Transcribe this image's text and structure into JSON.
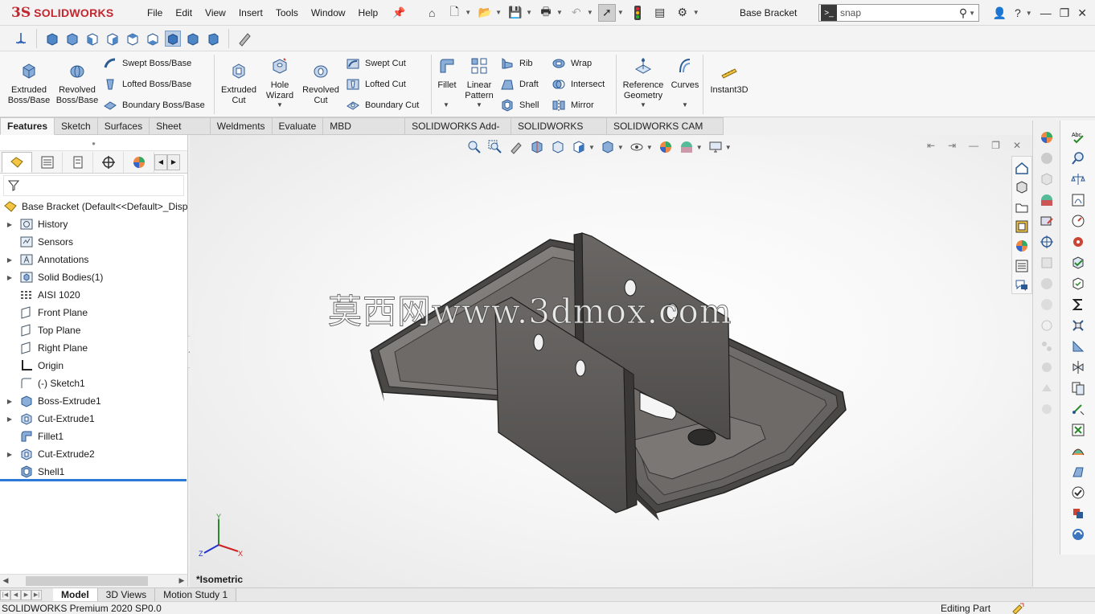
{
  "app": {
    "logo_ds": "3S",
    "logo_text": "SOLIDWORKS",
    "document_title": "Base Bracket"
  },
  "menu": [
    "File",
    "Edit",
    "View",
    "Insert",
    "Tools",
    "Window",
    "Help"
  ],
  "search": {
    "value": "snap"
  },
  "command_manager": {
    "extruded_boss": "Extruded Boss/Base",
    "revolved_boss": "Revolved Boss/Base",
    "swept_boss": "Swept Boss/Base",
    "lofted_boss": "Lofted Boss/Base",
    "boundary_boss": "Boundary Boss/Base",
    "extruded_cut": "Extruded Cut",
    "hole_wizard": "Hole Wizard",
    "revolved_cut": "Revolved Cut",
    "swept_cut": "Swept Cut",
    "lofted_cut": "Lofted Cut",
    "boundary_cut": "Boundary Cut",
    "fillet": "Fillet",
    "linear_pattern": "Linear Pattern",
    "rib": "Rib",
    "draft": "Draft",
    "shell": "Shell",
    "wrap": "Wrap",
    "intersect": "Intersect",
    "mirror": "Mirror",
    "reference_geometry": "Reference Geometry",
    "curves": "Curves",
    "instant3d": "Instant3D"
  },
  "command_tabs": [
    "Features",
    "Sketch",
    "Surfaces",
    "Sheet Metal",
    "Weldments",
    "Evaluate",
    "MBD Dimensions",
    "SOLIDWORKS Add-Ins",
    "SOLIDWORKS CAM",
    "SOLIDWORKS CAM TBM"
  ],
  "feature_tree": {
    "root": "Base Bracket  (Default<<Default>_Disp",
    "items": [
      "History",
      "Sensors",
      "Annotations",
      "Solid Bodies(1)",
      "AISI 1020",
      "Front Plane",
      "Top Plane",
      "Right Plane",
      "Origin",
      "(-) Sketch1",
      "Boss-Extrude1",
      "Cut-Extrude1",
      "Fillet1",
      "Cut-Extrude2",
      "Shell1"
    ]
  },
  "viewport": {
    "watermark": "莫西网www.3dmox.com",
    "view_name": "*Isometric",
    "triad_x": "X",
    "triad_y": "Y",
    "triad_z": "Z"
  },
  "bottom_tabs": [
    "Model",
    "3D Views",
    "Motion Study 1"
  ],
  "status": {
    "left": "SOLIDWORKS Premium 2020 SP0.0",
    "right": "Editing Part"
  },
  "colors": {
    "brand": "#c4262e",
    "model": "#6e6b68",
    "rollback": "#2d7ad6"
  }
}
